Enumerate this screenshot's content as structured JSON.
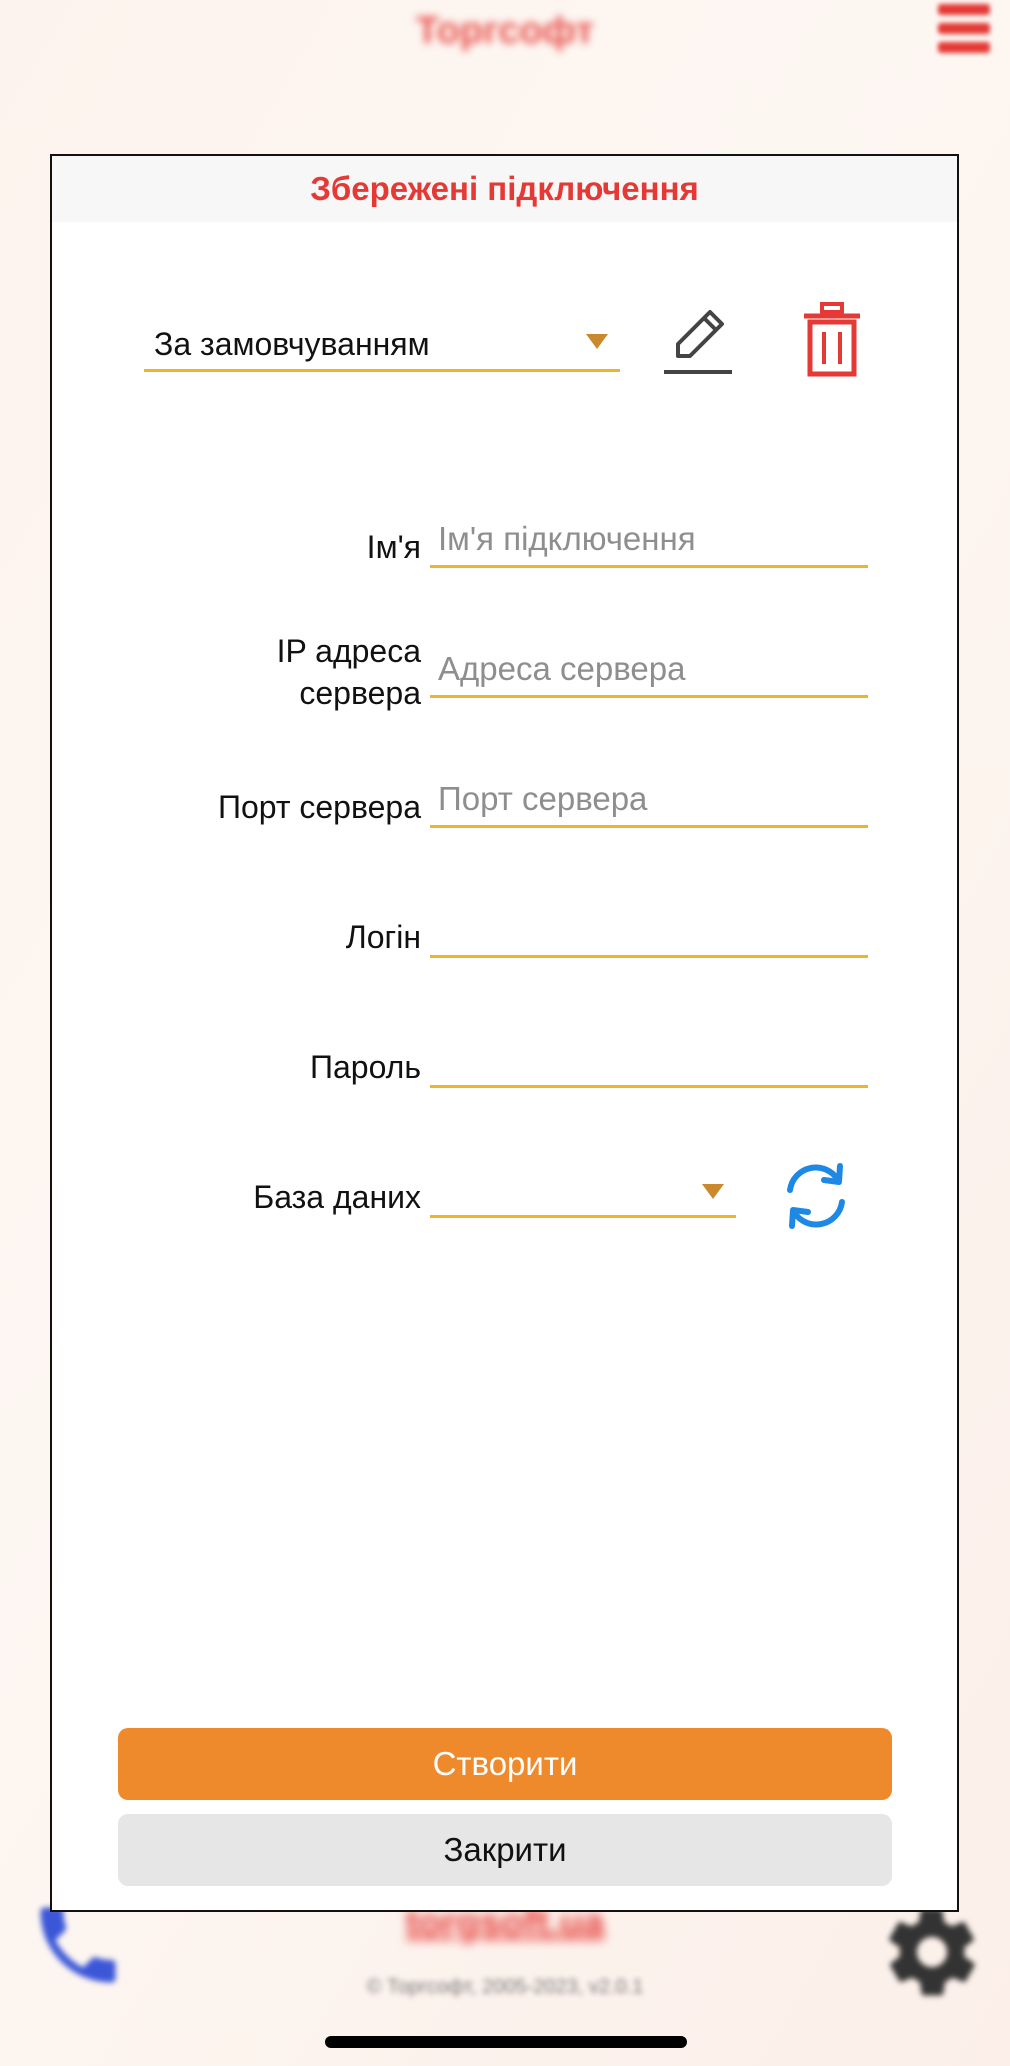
{
  "background": {
    "brand": "Торгсофт",
    "site_link": "torgsoft.ua",
    "copyright": "© Торгсофт, 2005-2023, v2.0.1",
    "menu_icon": "hamburger-menu-icon",
    "phone_icon": "phone-icon",
    "settings_icon": "gear-icon"
  },
  "modal": {
    "title": "Збережені підключення",
    "saved_connection": {
      "selected": "За замовчуванням",
      "edit_icon": "pencil-icon",
      "delete_icon": "trash-icon"
    },
    "fields": {
      "name": {
        "label": "Ім'я",
        "value": "",
        "placeholder": "Ім'я підключення"
      },
      "ip": {
        "label_line1": "IP адреса",
        "label_line2": "сервера",
        "value": "",
        "placeholder": "Адреса сервера"
      },
      "port": {
        "label": "Порт сервера",
        "value": "",
        "placeholder": "Порт сервера"
      },
      "login": {
        "label": "Логін",
        "value": "",
        "placeholder": ""
      },
      "password": {
        "label": "Пароль",
        "value": "",
        "placeholder": ""
      },
      "database": {
        "label": "База даних",
        "selected": "",
        "refresh_icon": "refresh-icon"
      }
    },
    "buttons": {
      "create": "Створити",
      "close": "Закрити"
    }
  },
  "colors": {
    "accent": "#ef8a2c",
    "underline": "#f0b429",
    "title_red": "#e53935",
    "refresh_blue": "#1e88e5"
  }
}
